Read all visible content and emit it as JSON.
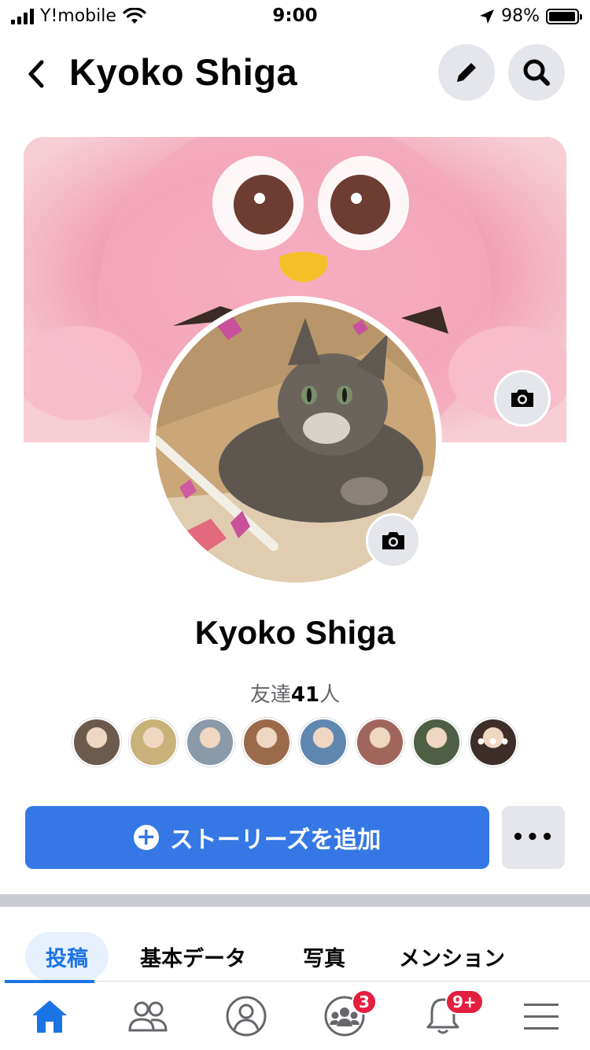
{
  "status_bar": {
    "carrier": "Y!mobile",
    "time": "9:00",
    "battery": "98%",
    "battery_level": 0.98
  },
  "header": {
    "title": "Kyoko Shiga",
    "back_icon": "chevron-left-icon",
    "edit_icon": "pencil-icon",
    "search_icon": "search-icon"
  },
  "profile": {
    "name": "Kyoko Shiga",
    "friends_prefix": "友達",
    "friends_count": "41",
    "friends_suffix": "人",
    "friend_avatars": [
      {
        "color": "#6b5a4e"
      },
      {
        "color": "#c8b27a"
      },
      {
        "color": "#8a9aa8"
      },
      {
        "color": "#9a6a4a"
      },
      {
        "color": "#5f87b0"
      },
      {
        "color": "#a0665c"
      },
      {
        "color": "#4f5f45"
      },
      {
        "color": "#3d2e2a"
      }
    ],
    "more_friends": "•••"
  },
  "actions": {
    "add_story_label": "ストーリーズを追加",
    "more_label": "•••"
  },
  "tabs": [
    {
      "label": "投稿",
      "active": true
    },
    {
      "label": "基本データ",
      "active": false
    },
    {
      "label": "写真",
      "active": false
    },
    {
      "label": "メンション",
      "active": false
    }
  ],
  "bottom_nav": {
    "items": [
      {
        "name": "home",
        "icon": "home-icon",
        "active": true
      },
      {
        "name": "friends",
        "icon": "friends-icon",
        "active": false
      },
      {
        "name": "profile",
        "icon": "profile-icon",
        "active": false
      },
      {
        "name": "groups",
        "icon": "groups-icon",
        "badge": "3",
        "active": false
      },
      {
        "name": "notifications",
        "icon": "bell-icon",
        "badge": "9+",
        "active": false
      },
      {
        "name": "menu",
        "icon": "hamburger-menu-icon",
        "active": false
      }
    ]
  },
  "colors": {
    "accent": "#1b74e4",
    "button_blue": "#3578e5",
    "badge_red": "#e41e3f",
    "button_gray": "#e4e6eb"
  }
}
